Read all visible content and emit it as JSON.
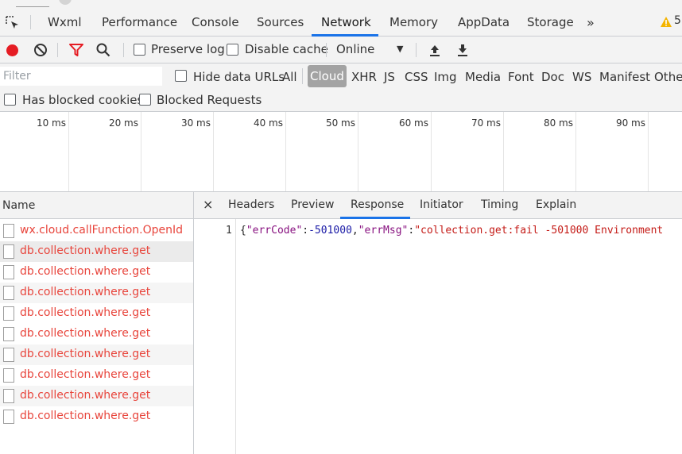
{
  "tabs": [
    {
      "label": "Wxml"
    },
    {
      "label": "Performance"
    },
    {
      "label": "Console"
    },
    {
      "label": "Sources"
    },
    {
      "label": "Network",
      "active": true
    },
    {
      "label": "Memory"
    },
    {
      "label": "AppData"
    },
    {
      "label": "Storage"
    }
  ],
  "more_tabs": "»",
  "warning_count": "5",
  "toolbar": {
    "preserve_log": "Preserve log",
    "disable_cache": "Disable cache",
    "throttling": "Online"
  },
  "filter": {
    "placeholder": "Filter",
    "hide_data_urls": "Hide data URLs",
    "types": [
      "All",
      "Cloud",
      "XHR",
      "JS",
      "CSS",
      "Img",
      "Media",
      "Font",
      "Doc",
      "WS",
      "Manifest",
      "Othe"
    ],
    "active_type": "Cloud"
  },
  "blocked": {
    "has_blocked_cookies": "Has blocked cookies",
    "blocked_requests": "Blocked Requests"
  },
  "timeline": {
    "ticks": [
      "10 ms",
      "20 ms",
      "30 ms",
      "40 ms",
      "50 ms",
      "60 ms",
      "70 ms",
      "80 ms",
      "90 ms"
    ]
  },
  "list": {
    "name_header": "Name",
    "rows": [
      "wx.cloud.callFunction.OpenId",
      "db.collection.where.get",
      "db.collection.where.get",
      "db.collection.where.get",
      "db.collection.where.get",
      "db.collection.where.get",
      "db.collection.where.get",
      "db.collection.where.get",
      "db.collection.where.get",
      "db.collection.where.get"
    ]
  },
  "detail": {
    "close": "×",
    "tabs": [
      "Headers",
      "Preview",
      "Response",
      "Initiator",
      "Timing",
      "Explain"
    ],
    "active_tab": "Response",
    "line_number": "1",
    "response": {
      "open": "{",
      "key1": "\"errCode\"",
      "colon1": ":",
      "val1": "-501000",
      "comma": ",",
      "key2": "\"errMsg\"",
      "colon2": ":",
      "val2": "\"collection.get:fail -501000 Environment"
    }
  },
  "colors": {
    "accent": "#1a73e8",
    "record": "#e51c23",
    "error_text": "#e8453c",
    "warning": "#f4b400"
  }
}
